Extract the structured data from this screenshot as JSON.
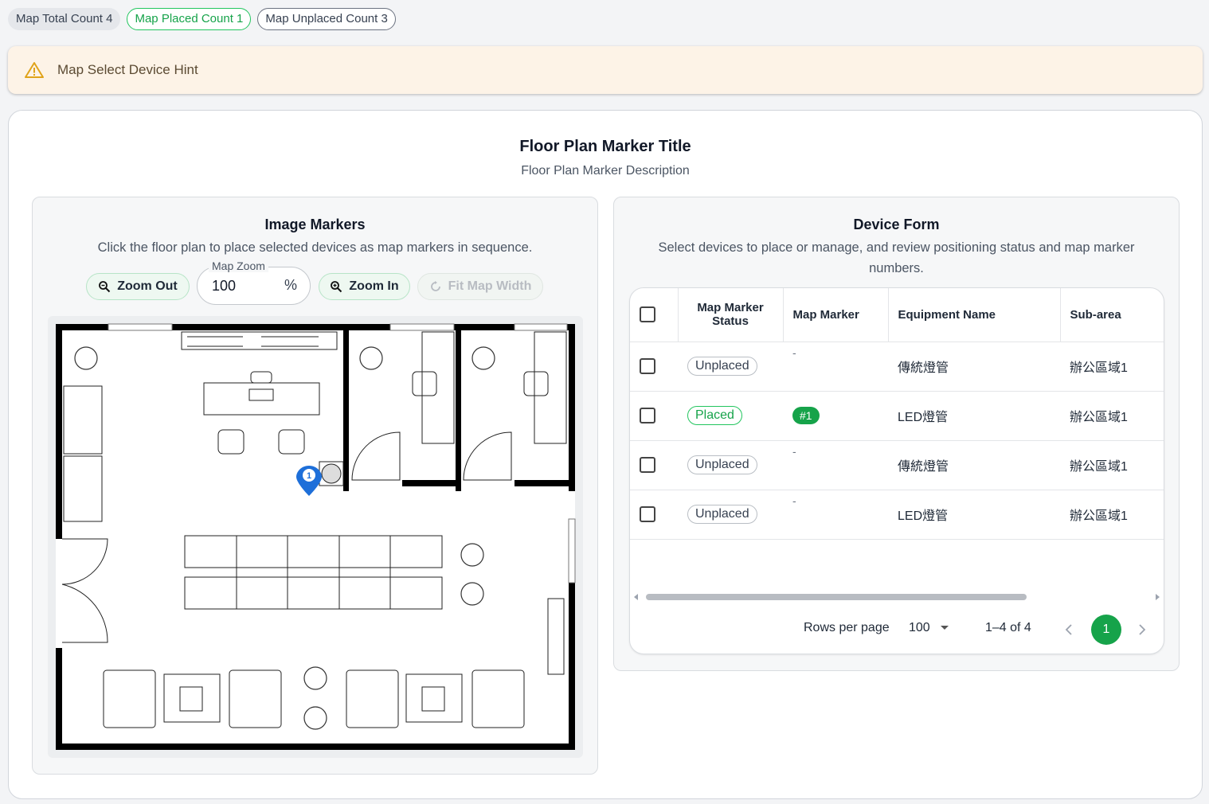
{
  "chips": {
    "total": "Map Total Count 4",
    "placed": "Map Placed Count 1",
    "unplaced": "Map Unplaced Count 3"
  },
  "hint": {
    "text": "Map Select Device Hint",
    "icon": "warning-icon"
  },
  "card": {
    "title": "Floor Plan Marker Title",
    "description": "Floor Plan Marker Description"
  },
  "image_markers": {
    "title": "Image Markers",
    "description": "Click the floor plan to place selected devices as map markers in sequence.",
    "zoom_out": "Zoom Out",
    "zoom_label": "Map Zoom",
    "zoom_value": "100",
    "zoom_unit": "%",
    "zoom_in": "Zoom In",
    "fit_width": "Fit Map Width",
    "marker_label": "1"
  },
  "device_form": {
    "title": "Device Form",
    "description": "Select devices to place or manage, and review positioning status and map marker numbers.",
    "columns": [
      "Map Marker Status",
      "Map Marker",
      "Equipment Name",
      "Sub-area"
    ],
    "rows": [
      {
        "status": "Unplaced",
        "marker": "-",
        "name": "傳統燈管",
        "area": "辦公區域1"
      },
      {
        "status": "Placed",
        "marker": "#1",
        "name": "LED燈管",
        "area": "辦公區域1"
      },
      {
        "status": "Unplaced",
        "marker": "-",
        "name": "傳統燈管",
        "area": "辦公區域1"
      },
      {
        "status": "Unplaced",
        "marker": "-",
        "name": "LED燈管",
        "area": "辦公區域1"
      }
    ],
    "rows_per_page_label": "Rows per page",
    "rows_per_page": "100",
    "range": "1–4 of 4",
    "page": "1"
  },
  "colors": {
    "accent": "#16a34a",
    "marker": "#1e6fd9",
    "hint_bg": "#fdf3e7",
    "warning": "#e0a31a"
  }
}
